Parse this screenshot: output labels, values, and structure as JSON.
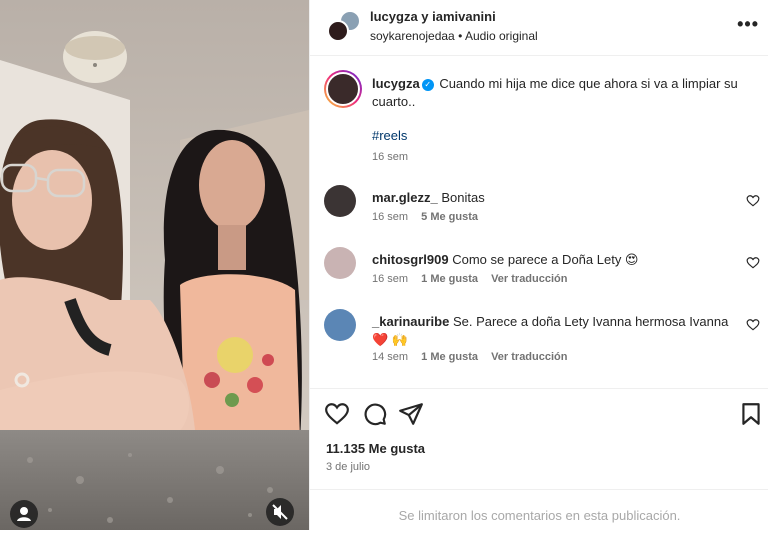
{
  "header": {
    "names": "lucygza y iamivanini",
    "sub_user": "soykarenojedaa",
    "sub_separator": "•",
    "sub_audio": "Audio original",
    "more_glyph": "•••"
  },
  "caption": {
    "username": "lucygza",
    "text": "Cuando mi hija me dice que ahora si va a limpiar su cuarto..",
    "hashtag": "#reels",
    "time": "16 sem"
  },
  "comments": [
    {
      "username": "mar.glezz_",
      "text": "Bonitas",
      "time": "16 sem",
      "likes": "5 Me gusta",
      "translate": ""
    },
    {
      "username": "chitosgrl909",
      "text": "Como se parece a Doña Lety 😍",
      "time": "16 sem",
      "likes": "1 Me gusta",
      "translate": "Ver traducción"
    },
    {
      "username": "_karinauribe",
      "text": "Se. Parece a doña Lety Ivanna hermosa Ivanna ❤️ 🙌",
      "time": "14 sem",
      "likes": "1 Me gusta",
      "translate": "Ver traducción"
    }
  ],
  "post": {
    "likes": "11.135 Me gusta",
    "date": "3 de julio"
  },
  "footer": {
    "notice": "Se limitaron los comentarios en esta publicación."
  },
  "colors": {
    "link": "#00376b",
    "muted": "#737373",
    "verified": "#0095f6"
  }
}
